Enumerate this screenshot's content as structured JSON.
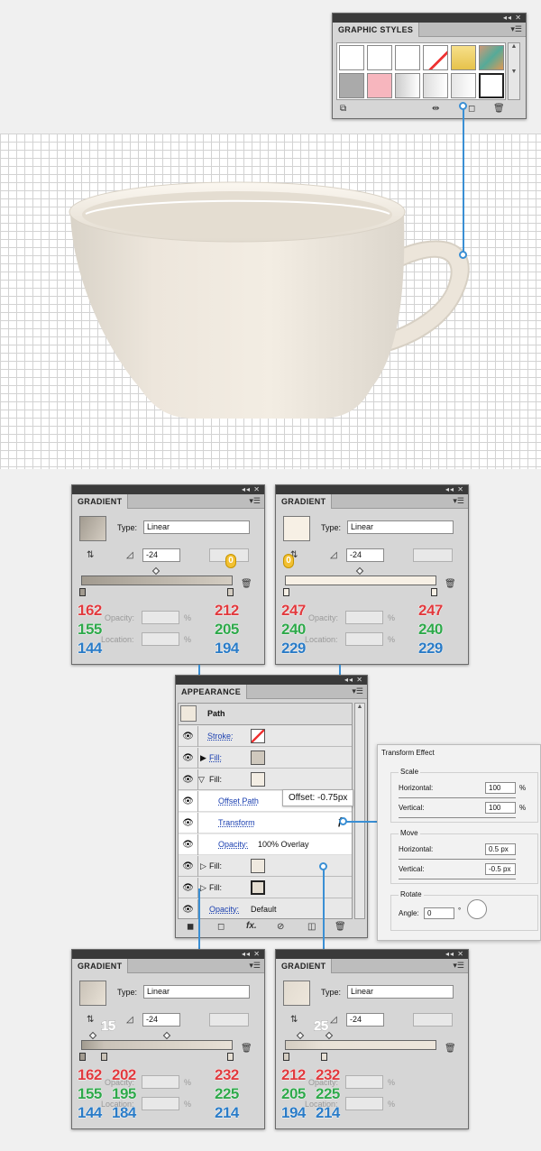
{
  "graphic_styles": {
    "title": "GRAPHIC STYLES",
    "controls": "◂◂ ✕",
    "menu": "▾☰"
  },
  "gradient_panels": [
    {
      "title": "GRADIENT",
      "type_label": "Type:",
      "type_value": "Linear",
      "angle": "-24",
      "badge": "0",
      "r1": "162",
      "g1": "155",
      "b1": "144",
      "r2": "212",
      "g2": "205",
      "b2": "194",
      "opacity_label": "Opacity:",
      "location_label": "Location:",
      "pct": "%"
    },
    {
      "title": "GRADIENT",
      "type_label": "Type:",
      "type_value": "Linear",
      "angle": "-24",
      "badge": "0",
      "r1": "247",
      "g1": "240",
      "b1": "229",
      "r2": "247",
      "g2": "240",
      "b2": "229",
      "opacity_label": "Opacity:",
      "location_label": "Location:",
      "pct": "%"
    },
    {
      "title": "GRADIENT",
      "type_label": "Type:",
      "type_value": "Linear",
      "angle": "-24",
      "badge": "15",
      "r1": "162",
      "g1": "155",
      "b1": "144",
      "rm": "202",
      "gm": "195",
      "bm": "184",
      "r2": "232",
      "g2": "225",
      "b2": "214",
      "opacity_label": "Opacity:",
      "location_label": "Location:",
      "pct": "%"
    },
    {
      "title": "GRADIENT",
      "type_label": "Type:",
      "type_value": "Linear",
      "angle": "-24",
      "badge": "25",
      "r1": "212",
      "g1": "205",
      "b1": "194",
      "rm": "232",
      "gm": "225",
      "bm": "214",
      "opacity_label": "Opacity:",
      "location_label": "Location:",
      "pct": "%"
    }
  ],
  "appearance": {
    "title": "APPEARANCE",
    "path": "Path",
    "rows": [
      "Stroke:",
      "Fill:",
      "Fill:",
      "Offset Path",
      "Transform",
      "Opacity:",
      "Fill:",
      "Fill:",
      "Opacity:"
    ],
    "opacity_value": "100% Overlay",
    "default_value": "Default",
    "tooltip": "Offset: -0.75px"
  },
  "transform_effect": {
    "title": "Transform Effect",
    "scale": "Scale",
    "horizontal": "Horizontal:",
    "vertical": "Vertical:",
    "h_scale": "100",
    "v_scale": "100",
    "pct": "%",
    "move": "Move",
    "h_move": "0.5 px",
    "v_move": "-0.5 px",
    "rotate": "Rotate",
    "angle_label": "Angle:",
    "angle_value": "0",
    "degree": "°"
  },
  "colors": {
    "red": "#e03a3e",
    "green": "#2ea84a",
    "blue": "#2a7bc6",
    "connector": "#3a8fd4"
  }
}
